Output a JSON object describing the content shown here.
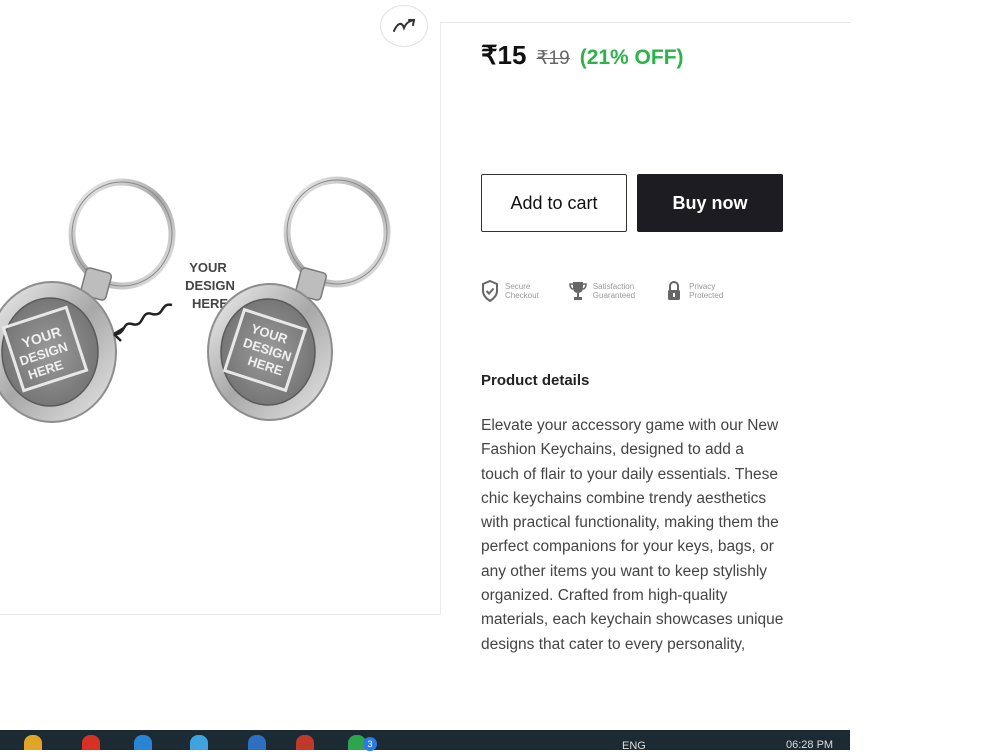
{
  "price": {
    "current": "₹15",
    "original": "₹19",
    "discount": "(21% OFF)"
  },
  "actions": {
    "add_to_cart": "Add to cart",
    "buy_now": "Buy now"
  },
  "badges": [
    {
      "icon": "shield-check-icon",
      "line1": "Secure",
      "line2": "Checkout"
    },
    {
      "icon": "trophy-icon",
      "line1": "Satisfaction",
      "line2": "Guaranteed"
    },
    {
      "icon": "lock-icon",
      "line1": "Privacy",
      "line2": "Protected"
    }
  ],
  "product_image": {
    "callout": [
      "YOUR",
      "DESIGN",
      "HERE"
    ],
    "plate_text": [
      "YOUR",
      "DESIGN",
      "HERE"
    ]
  },
  "details": {
    "title": "Product details",
    "description": "Elevate your accessory game with our New Fashion Keychains, designed to add a touch of flair to your daily essentials. These chic keychains combine trendy aesthetics with practical functionality, making them the perfect companions for your keys, bags, or any other items you want to keep stylishly organized. Crafted from high-quality materials, each keychain showcases unique designs that cater to every personality,"
  },
  "taskbar": {
    "language": "ENG",
    "time": "06:28 PM",
    "notification_count": "3"
  },
  "colors": {
    "discount_green": "#2db34a",
    "buy_button_bg": "#1c1c22",
    "taskbar_bg": "#1c2b33"
  }
}
